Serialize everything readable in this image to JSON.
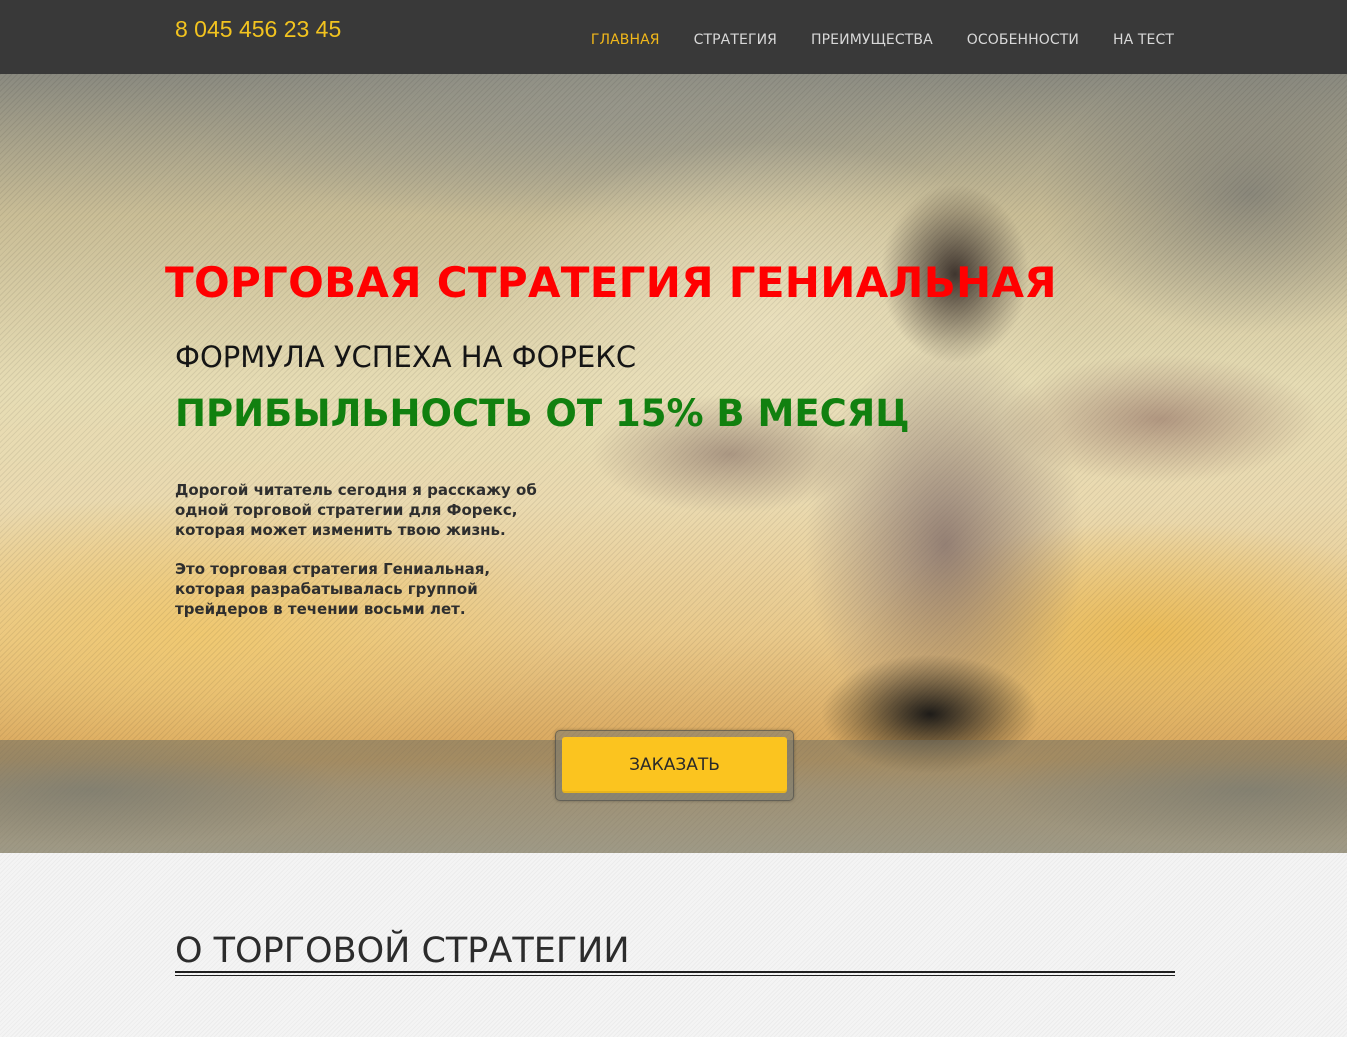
{
  "header": {
    "phone": "8 045 456 23 45",
    "nav": [
      {
        "label": "ГЛАВНАЯ",
        "active": true
      },
      {
        "label": "СТРАТЕГИЯ",
        "active": false
      },
      {
        "label": "ПРЕИМУЩЕСТВА",
        "active": false
      },
      {
        "label": "ОСОБЕННОСТИ",
        "active": false
      },
      {
        "label": "НА ТЕСТ",
        "active": false
      }
    ]
  },
  "hero": {
    "title": "ТОРГОВАЯ СТРАТЕГИЯ ГЕНИАЛЬНАЯ",
    "subtitle": "ФОРМУЛА УСПЕХА НА ФОРЕКС",
    "profit": "ПРИБЫЛЬНОСТЬ ОТ 15% В МЕСЯЦ",
    "paragraphs": [
      "Дорогой читатель сегодня я расскажу об одной торговой стратегии для Форекс, которая может изменить твою жизнь.",
      "Это торговая стратегия Гениальная, которая разрабатывалась группой трейдеров в течении восьми лет."
    ],
    "order_button": "ЗАКАЗАТЬ"
  },
  "about": {
    "title": "О ТОРГОВОЙ СТРАТЕГИИ"
  },
  "colors": {
    "header_bg": "#393939",
    "accent_yellow": "#f2c31f",
    "title_red": "#ff0000",
    "profit_green": "#11800f",
    "button_yellow": "#fbc41f"
  }
}
